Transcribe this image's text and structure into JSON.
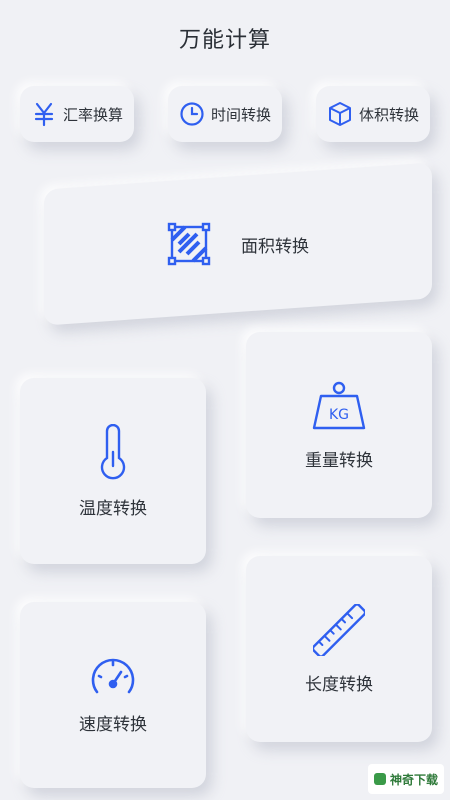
{
  "header": {
    "title": "万能计算"
  },
  "pills": [
    {
      "label": "汇率换算",
      "icon": "yen-icon"
    },
    {
      "label": "时间转换",
      "icon": "clock-icon"
    },
    {
      "label": "体积转换",
      "icon": "cube-icon"
    }
  ],
  "tiles": {
    "area": {
      "label": "面积转换",
      "icon": "area-icon"
    },
    "weight": {
      "label": "重量转换",
      "icon": "weight-icon",
      "icon_text": "KG"
    },
    "temperature": {
      "label": "温度转换",
      "icon": "thermometer-icon"
    },
    "length": {
      "label": "长度转换",
      "icon": "ruler-icon"
    },
    "speed": {
      "label": "速度转换",
      "icon": "speedometer-icon"
    }
  },
  "watermark": {
    "text": "神奇下载"
  },
  "colors": {
    "accent": "#2f5ff0",
    "background": "#f0f1f5"
  }
}
